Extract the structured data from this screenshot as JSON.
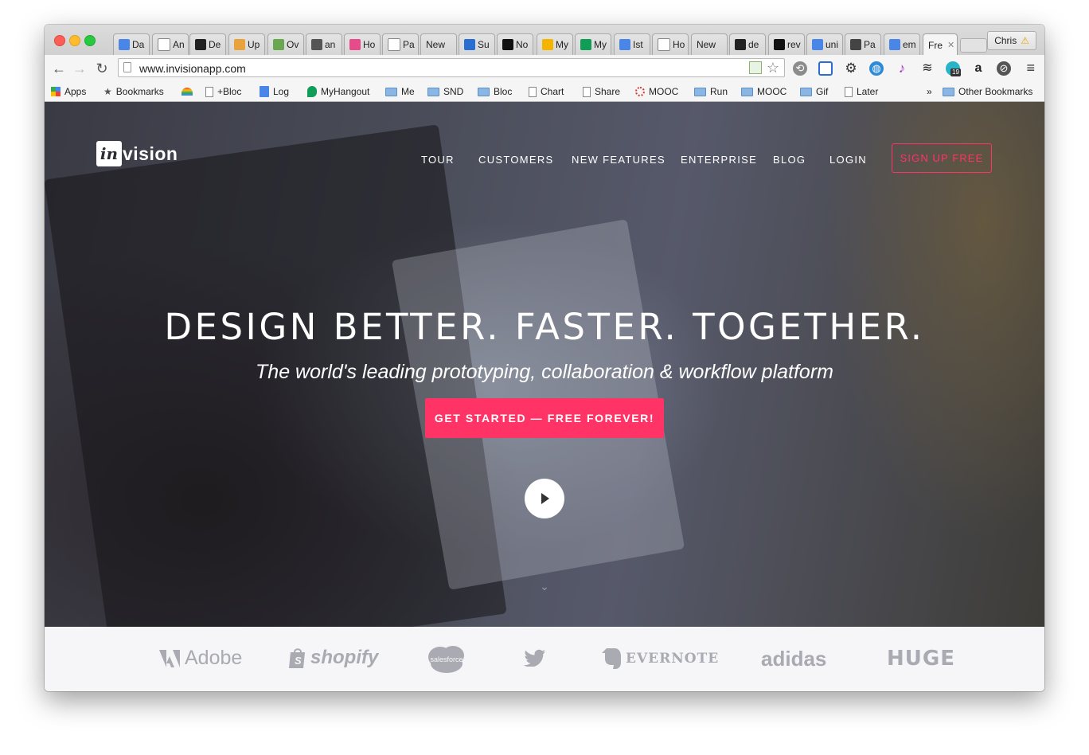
{
  "browser": {
    "tabs": [
      {
        "label": "Da",
        "icon": "google-docs-icon",
        "color": "#4a86e8"
      },
      {
        "label": "An",
        "icon": "page-icon",
        "color": "#ffffff"
      },
      {
        "label": "De",
        "icon": "bloc-icon",
        "color": "#222222"
      },
      {
        "label": "Up",
        "icon": "calendar-icon",
        "color": "#e8a33d"
      },
      {
        "label": "Ov",
        "icon": "shield-icon",
        "color": "#6aa84f"
      },
      {
        "label": "an",
        "icon": "columns-icon",
        "color": "#555555"
      },
      {
        "label": "Ho",
        "icon": "tg-icon",
        "color": "#e84b8a"
      },
      {
        "label": "Pa",
        "icon": "page-icon",
        "color": "#ffffff"
      },
      {
        "label": "New",
        "icon": "none",
        "color": ""
      },
      {
        "label": "Su",
        "icon": "circle-icon",
        "color": "#2b6ed1"
      },
      {
        "label": "No",
        "icon": "bw-icon",
        "color": "#111111"
      },
      {
        "label": "My",
        "icon": "drive-icon",
        "color": "#f4b400"
      },
      {
        "label": "My",
        "icon": "drive-icon",
        "color": "#0f9d58"
      },
      {
        "label": "Ist",
        "icon": "google-docs-icon",
        "color": "#4a86e8"
      },
      {
        "label": "Ho",
        "icon": "page-icon",
        "color": "#ffffff"
      },
      {
        "label": "New",
        "icon": "none",
        "color": ""
      },
      {
        "label": "de",
        "icon": "github-icon",
        "color": "#222222"
      },
      {
        "label": "rev",
        "icon": "s-icon",
        "color": "#111111"
      },
      {
        "label": "uni",
        "icon": "google-icon",
        "color": "#4a86e8"
      },
      {
        "label": "Pa",
        "icon": "smile-icon",
        "color": "#444444"
      },
      {
        "label": "em",
        "icon": "google-icon",
        "color": "#4a86e8"
      },
      {
        "label": "Fre",
        "icon": "none",
        "color": ""
      }
    ],
    "profile_name": "Chris",
    "url": "www.invisionapp.com",
    "bookmarks": [
      {
        "label": "Apps",
        "icon": "apps-icon"
      },
      {
        "label": "Bookmarks",
        "icon": "star-icon"
      },
      {
        "label": "",
        "icon": "rainbow-icon"
      },
      {
        "label": "+Bloc",
        "icon": "doc-icon"
      },
      {
        "label": "Log",
        "icon": "google-docs-icon"
      },
      {
        "label": "MyHangout",
        "icon": "hangout-icon"
      },
      {
        "label": "Me",
        "icon": "folder-icon"
      },
      {
        "label": "SND",
        "icon": "folder-icon"
      },
      {
        "label": "Bloc",
        "icon": "folder-icon"
      },
      {
        "label": "Chart",
        "icon": "doc-icon"
      },
      {
        "label": "Share",
        "icon": "doc-icon"
      },
      {
        "label": "MOOC",
        "icon": "ring-icon"
      },
      {
        "label": "Run",
        "icon": "folder-icon"
      },
      {
        "label": "MOOC",
        "icon": "folder-icon"
      },
      {
        "label": "Gif",
        "icon": "folder-icon"
      },
      {
        "label": "Later",
        "icon": "doc-icon"
      }
    ],
    "bookmarks_overflow": "»",
    "other_bookmarks": "Other Bookmarks",
    "extension_badge": "19"
  },
  "site": {
    "logo_in": "in",
    "logo_rest": "vision",
    "nav": [
      "TOUR",
      "CUSTOMERS",
      "NEW FEATURES",
      "ENTERPRISE",
      "BLOG",
      "LOGIN"
    ],
    "signup": "SIGN UP FREE",
    "headline": "DESIGN BETTER. FASTER. TOGETHER.",
    "subline": "The world's leading prototyping, collaboration & workflow platform",
    "cta": "GET STARTED — FREE FOREVER!",
    "customers": [
      "Adobe",
      "shopify",
      "salesforce",
      "twitter",
      "EVERNOTE",
      "adidas",
      "HUGE"
    ],
    "accent": "#ff3366"
  }
}
